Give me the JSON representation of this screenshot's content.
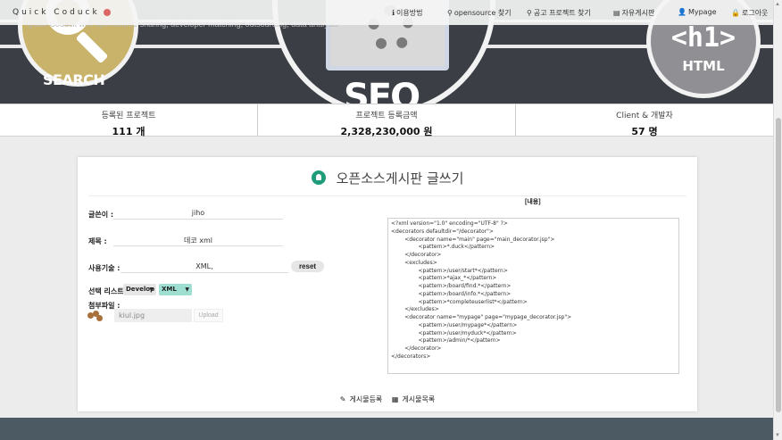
{
  "brand": {
    "logo_text": "Quick Coduck"
  },
  "nav": [
    {
      "icon": "info-icon",
      "glyph": "ℹ",
      "label": "이용방법"
    },
    {
      "icon": "search-icon",
      "glyph": "⚲",
      "label": "opensource 찾기"
    },
    {
      "icon": "search-icon",
      "glyph": "⚲",
      "label": "공고 프로젝트 찾기"
    },
    {
      "icon": "keyboard-icon",
      "glyph": "▤",
      "label": "자유게시판"
    },
    {
      "icon": "user-icon",
      "glyph": "👤",
      "label": "Mypage"
    },
    {
      "icon": "lock-icon",
      "glyph": "🔒",
      "label": "로그아웃"
    }
  ],
  "hero": {
    "search_label": "SEARCH",
    "seo_label": "SEO",
    "html_tag": "<h1>",
    "html_label": "HTML",
    "ghost_text": "Quick Coduck with opensource sharing, developer matching, outsourcing, data analysis"
  },
  "stats": [
    {
      "label": "등록된 프로젝트",
      "value": "111 개"
    },
    {
      "label": "프로젝트 등록금액",
      "value": "2,328,230,000 원"
    },
    {
      "label": "Client & 개발자",
      "value": "57 명"
    }
  ],
  "form": {
    "title": "오픈소스게시판 글쓰기",
    "writer_label": "글쓴이 :",
    "writer_value": "jiho",
    "subject_label": "제목 :",
    "subject_value": "데코 xml",
    "tech_label": "사용기술 :",
    "tech_value": "XML,",
    "reset_label": "reset",
    "select_label": "선택 리스트:",
    "select_category": "Develop",
    "select_tech": "XML",
    "attach_label": "첨부파일 :",
    "file_name": "kiul.jpg",
    "upload_label": "Upload",
    "content_label": "[내용]",
    "content": "<?xml version=\"1.0\" encoding=\"UTF-8\" ?>\n<decorators defaultdir=\"/decorator\">\n        <decorator name=\"main\" page=\"main_decorator.jsp\">\n                <pattern>*.duck</pattern>\n        </decorator>\n        <excludes>\n                <pattern>/user/start*</pattern>\n                <pattern>*ajax_*</pattern>\n                <pattern>/board/find.*</pattern>\n                <pattern>/board/info.*</pattern>\n                <pattern>*completeuserlist*</pattern>\n        </excludes>\n        <decorator name=\"mypage\" page=\"mypage_decorator.jsp\">\n                <pattern>/user/mypage*</pattern>\n                <pattern>/user/myduck*</pattern>\n                <pattern>/admin/*</pattern>\n        </decorator>\n</decorators>",
    "submit_label": "게시물등록",
    "list_label": "게시물목록"
  }
}
